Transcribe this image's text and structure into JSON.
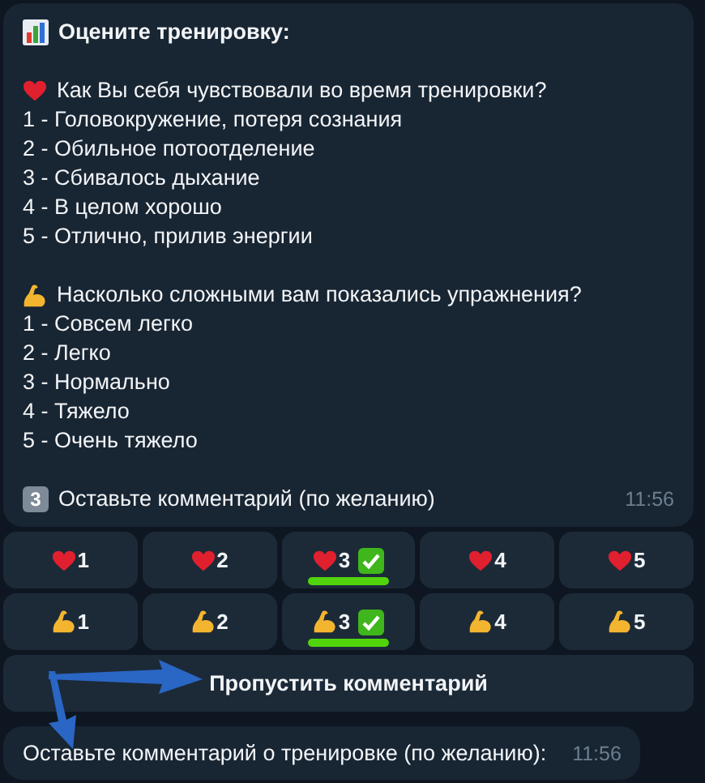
{
  "message": {
    "title": "Оцените тренировку:",
    "sections": [
      {
        "kind": "heart",
        "question": "Как Вы себя чувствовали во время тренировки?",
        "options": [
          "1 - Головокружение, потеря сознания",
          "2 - Обильное потоотделение",
          "3 - Сбивалось дыхание",
          "4 - В целом хорошо",
          "5 - Отлично, прилив энергии"
        ]
      },
      {
        "kind": "muscle",
        "question": "Насколько сложными вам показались упражнения?",
        "options": [
          "1 - Совсем легко",
          "2 - Легко",
          "3 - Нормально",
          "4 - Тяжело",
          "5 - Очень тяжело"
        ]
      }
    ],
    "footer": {
      "keycap": "3",
      "text": "Оставьте комментарий (по желанию)"
    },
    "time": "11:56"
  },
  "keyboard": {
    "rows": [
      {
        "kind": "heart",
        "buttons": [
          {
            "label": "1",
            "selected": false
          },
          {
            "label": "2",
            "selected": false
          },
          {
            "label": "3",
            "selected": true
          },
          {
            "label": "4",
            "selected": false
          },
          {
            "label": "5",
            "selected": false
          }
        ]
      },
      {
        "kind": "muscle",
        "buttons": [
          {
            "label": "1",
            "selected": false
          },
          {
            "label": "2",
            "selected": false
          },
          {
            "label": "3",
            "selected": true
          },
          {
            "label": "4",
            "selected": false
          },
          {
            "label": "5",
            "selected": false
          }
        ]
      }
    ],
    "skip_button": "Пропустить комментарий"
  },
  "reply": {
    "text": "Оставьте комментарий о тренировке (по желанию):",
    "time": "11:56"
  },
  "annotations": [
    {
      "kind": "arrow"
    },
    {
      "kind": "arrow"
    }
  ]
}
